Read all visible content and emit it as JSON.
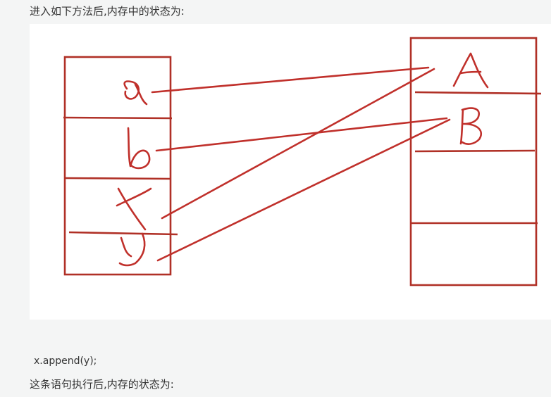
{
  "text": {
    "intro": "进入如下方法后,内存中的状态为:",
    "code": "x.append(y);",
    "after": "这条语句执行后,内存的状态为:"
  },
  "diagram": {
    "stack_labels": [
      "a",
      "b",
      "x",
      "y"
    ],
    "heap_labels": [
      "A",
      "B"
    ],
    "references": [
      {
        "from": "a",
        "to": "A"
      },
      {
        "from": "x",
        "to": "A"
      },
      {
        "from": "b",
        "to": "B"
      },
      {
        "from": "y",
        "to": "B"
      }
    ],
    "ink_color": "#c0302b"
  }
}
